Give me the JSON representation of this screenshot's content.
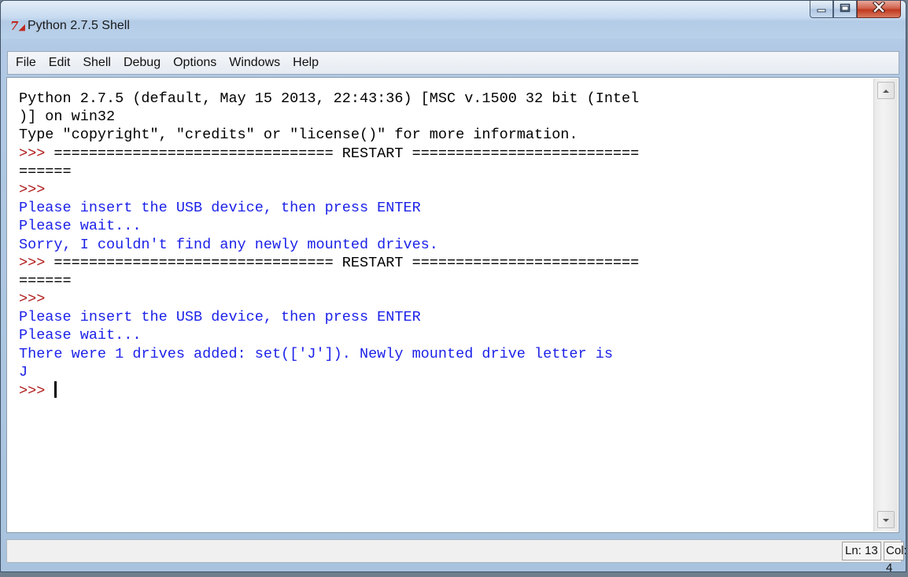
{
  "window": {
    "title": "Python 2.7.5 Shell",
    "app_icon": "python-idle-icon",
    "buttons": [
      "minimize-icon",
      "maximize-icon",
      "close-icon"
    ]
  },
  "menubar": {
    "items": [
      "File",
      "Edit",
      "Shell",
      "Debug",
      "Options",
      "Windows",
      "Help"
    ]
  },
  "console": {
    "lines": [
      {
        "type": "out",
        "text": "Python 2.7.5 (default, May 15 2013, 22:43:36) [MSC v.1500 32 bit (Intel"
      },
      {
        "type": "out",
        "text": ")] on win32"
      },
      {
        "type": "out",
        "text": "Type \"copyright\", \"credits\" or \"license()\" for more information."
      },
      {
        "type": "prompt_mix",
        "prompt": ">>>",
        "text": " ================================ RESTART =========================="
      },
      {
        "type": "out",
        "text": "======"
      },
      {
        "type": "prompt",
        "text": ">>>"
      },
      {
        "type": "stdout",
        "text": "Please insert the USB device, then press ENTER"
      },
      {
        "type": "stdout",
        "text": "Please wait..."
      },
      {
        "type": "stdout",
        "text": "Sorry, I couldn't find any newly mounted drives."
      },
      {
        "type": "prompt_mix",
        "prompt": ">>>",
        "text": " ================================ RESTART =========================="
      },
      {
        "type": "out",
        "text": "======"
      },
      {
        "type": "prompt",
        "text": ">>>"
      },
      {
        "type": "stdout",
        "text": "Please insert the USB device, then press ENTER"
      },
      {
        "type": "stdout",
        "text": "Please wait..."
      },
      {
        "type": "stdout",
        "text": "There were 1 drives added: set(['J']). Newly mounted drive letter is"
      },
      {
        "type": "stdout",
        "text": "J"
      },
      {
        "type": "prompt_cursor",
        "text": ">>> "
      }
    ]
  },
  "scrollbar": {
    "up_icon": "scroll-up-arrow-icon",
    "down_icon": "scroll-down-arrow-icon"
  },
  "status": {
    "line": "Ln: 13",
    "col": "Col: 4"
  },
  "colors": {
    "prompt": "#b01b1b",
    "stdout": "#1c22e8",
    "text": "#000000"
  }
}
